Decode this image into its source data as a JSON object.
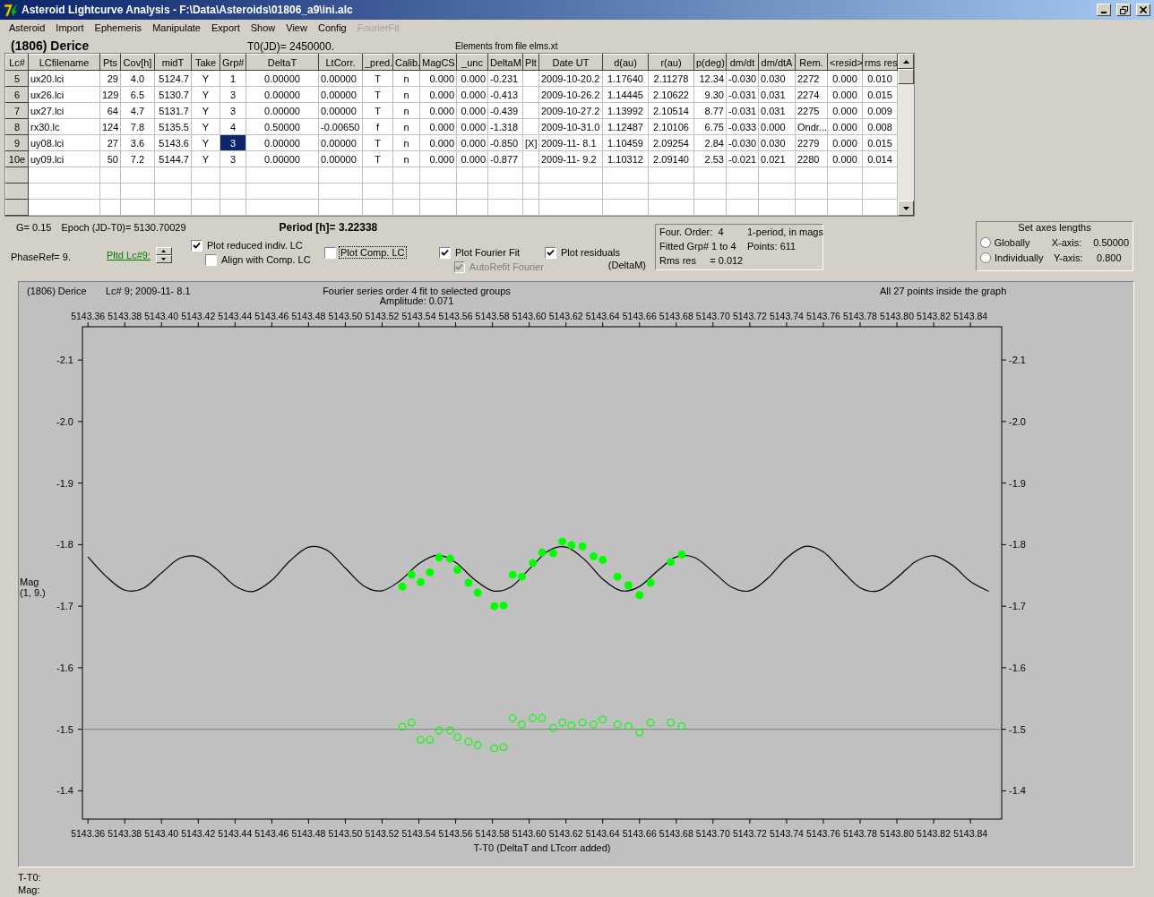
{
  "window": {
    "title": "Asteroid Lightcurve Analysis - F:\\Data\\Asteroids\\01806_a9\\ini.alc"
  },
  "menu": [
    {
      "label": "Asteroid",
      "disabled": false
    },
    {
      "label": "Import",
      "disabled": false
    },
    {
      "label": "Ephemeris",
      "disabled": false
    },
    {
      "label": "Manipulate",
      "disabled": false
    },
    {
      "label": "Export",
      "disabled": false
    },
    {
      "label": "Show",
      "disabled": false
    },
    {
      "label": "View",
      "disabled": false
    },
    {
      "label": "Config",
      "disabled": false
    },
    {
      "label": "FourierFit",
      "disabled": true
    }
  ],
  "info": {
    "asteroid": "(1806) Derice",
    "t0": "T0(JD)= 2450000.",
    "elements": "Elements from file elms.xt"
  },
  "table": {
    "columns": [
      "Lc#",
      "LCfilename",
      "Pts",
      "Cov[h]",
      "midT",
      "Take",
      "Grp#",
      "DeltaT",
      "LtCorr.",
      "_pred.",
      "Calib.",
      "MagCS",
      "_unc",
      "DeltaM",
      "Plt",
      "Date UT",
      "d(au)",
      "r(au)",
      "p(deg)",
      "dm/dt",
      "dm/dtA",
      "Rem.",
      "<resid>",
      "rms res"
    ],
    "rows": [
      {
        "selected": false,
        "cells": [
          "5",
          "ux20.lci",
          "29",
          "4.0",
          "5124.7",
          "Y",
          "1",
          "0.00000",
          "0.00000",
          "T",
          "n",
          "0.000",
          "0.000",
          "-0.231",
          null,
          "2009-10-20.2",
          "1.17640",
          "2.11278",
          "12.34",
          "-0.030",
          "0.030",
          "2272",
          "0.000",
          "0.010"
        ]
      },
      {
        "selected": false,
        "cells": [
          "6",
          "ux26.lci",
          "129",
          "6.5",
          "5130.7",
          "Y",
          "3",
          "0.00000",
          "0.00000",
          "T",
          "n",
          "0.000",
          "0.000",
          "-0.413",
          null,
          "2009-10-26.2",
          "1.14445",
          "2.10622",
          "9.30",
          "-0.031",
          "0.031",
          "2274",
          "0.000",
          "0.015"
        ]
      },
      {
        "selected": false,
        "cells": [
          "7",
          "ux27.lci",
          "64",
          "4.7",
          "5131.7",
          "Y",
          "3",
          "0.00000",
          "0.00000",
          "T",
          "n",
          "0.000",
          "0.000",
          "-0.439",
          null,
          "2009-10-27.2",
          "1.13992",
          "2.10514",
          "8.77",
          "-0.031",
          "0.031",
          "2275",
          "0.000",
          "0.009"
        ]
      },
      {
        "selected": false,
        "cells": [
          "8",
          "rx30.lc",
          "124",
          "7.8",
          "5135.5",
          "Y",
          "4",
          "0.50000",
          "-0.00650",
          "f",
          "n",
          "0.000",
          "0.000",
          "-1.318",
          null,
          "2009-10-31.0",
          "1.12487",
          "2.10106",
          "6.75",
          "-0.033",
          "0.000",
          "Ondr...",
          "0.000",
          "0.008"
        ]
      },
      {
        "selected": true,
        "cells": [
          "9",
          "uy08.lci",
          "27",
          "3.6",
          "5143.6",
          "Y",
          "3",
          "0.00000",
          "0.00000",
          "T",
          "n",
          "0.000",
          "0.000",
          "-0.850",
          "[X]",
          "2009-11- 8.1",
          "1.10459",
          "2.09254",
          "2.84",
          "-0.030",
          "0.030",
          "2279",
          "0.000",
          "0.015"
        ]
      },
      {
        "selected": false,
        "cells": [
          "10e",
          "uy09.lci",
          "50",
          "7.2",
          "5144.7",
          "Y",
          "3",
          "0.00000",
          "0.00000",
          "T",
          "n",
          "0.000",
          "0.000",
          "-0.877",
          null,
          "2009-11- 9.2",
          "1.10312",
          "2.09140",
          "2.53",
          "-0.021",
          "0.021",
          "2280",
          "0.000",
          "0.014"
        ]
      }
    ]
  },
  "params": {
    "g": "G= 0.15",
    "epoch": "Epoch (JD-T0)= 5130.70029",
    "period": "Period [h]= 3.22338",
    "phase_ref": "PhaseRef= 9.",
    "plotted_lc": "Pltd Lc#9:",
    "deltam_note": "(DeltaM)"
  },
  "checkboxes": [
    {
      "label": "Plot reduced indiv. LC",
      "checked": true,
      "disabled": false,
      "focused": false
    },
    {
      "label": "Align with Comp. LC",
      "checked": false,
      "disabled": false,
      "focused": false
    },
    {
      "label": "Plot Comp. LC",
      "checked": false,
      "disabled": false,
      "focused": true
    },
    {
      "label": "Plot Fourier Fit",
      "checked": true,
      "disabled": false,
      "focused": false
    },
    {
      "label": "AutoRefit Fourier",
      "checked": true,
      "disabled": true,
      "focused": false
    },
    {
      "label": "Plot residuals",
      "checked": true,
      "disabled": false,
      "focused": false
    }
  ],
  "fit_info": [
    [
      "Four. Order:  4",
      "1-period, in mags"
    ],
    [
      "Fitted Grp# 1 to 4",
      "Points: 611"
    ],
    [
      "Rms res     = 0.012"
    ]
  ],
  "axes_box": {
    "title": "Set axes lengths",
    "options": [
      {
        "label": "Globally",
        "selected": false,
        "axis": "X-axis:",
        "value": "0.50000"
      },
      {
        "label": "Individually",
        "selected": false,
        "axis": "Y-axis:",
        "value": "0.800"
      }
    ]
  },
  "plot": {
    "asteroid": "(1806) Derice",
    "lc": "Lc# 9; 2009-11- 8.1",
    "fit": "Fourier series order 4 fit to selected groups",
    "amplitude": "Amplitude: 0.071",
    "status": "All 27 points inside the graph",
    "y_note": "(1, 9.)",
    "chart_data": {
      "type": "scatter",
      "xlabel": "T-T0 (DeltaT and LTcorr added)",
      "ylabel": "Mag",
      "xlim": [
        5143.357,
        5143.857
      ],
      "ylim": [
        -1.354,
        -2.154
      ],
      "xticks": [
        {
          "value": 5143.36,
          "label": "5143.36"
        },
        {
          "value": 5143.38,
          "label": "5143.38"
        },
        {
          "value": 5143.4,
          "label": "5143.40"
        },
        {
          "value": 5143.42,
          "label": "5143.42"
        },
        {
          "value": 5143.44,
          "label": "5143.44"
        },
        {
          "value": 5143.46,
          "label": "5143.46"
        },
        {
          "value": 5143.48,
          "label": "5143.48"
        },
        {
          "value": 5143.5,
          "label": "5143.50"
        },
        {
          "value": 5143.52,
          "label": "5143.52"
        },
        {
          "value": 5143.54,
          "label": "5143.54"
        },
        {
          "value": 5143.56,
          "label": "5143.56"
        },
        {
          "value": 5143.58,
          "label": "5143.58"
        },
        {
          "value": 5143.6,
          "label": "5143.60"
        },
        {
          "value": 5143.62,
          "label": "5143.62"
        },
        {
          "value": 5143.64,
          "label": "5143.64"
        },
        {
          "value": 5143.66,
          "label": "5143.66"
        },
        {
          "value": 5143.68,
          "label": "5143.68"
        },
        {
          "value": 5143.7,
          "label": "5143.70"
        },
        {
          "value": 5143.72,
          "label": "5143.72"
        },
        {
          "value": 5143.74,
          "label": "5143.74"
        },
        {
          "value": 5143.76,
          "label": "5143.76"
        },
        {
          "value": 5143.78,
          "label": "5143.78"
        },
        {
          "value": 5143.8,
          "label": "5143.80"
        },
        {
          "value": 5143.82,
          "label": "5143.82"
        },
        {
          "value": 5143.84,
          "label": "5143.84"
        }
      ],
      "yticks": [
        {
          "value": -2.1,
          "label": "-2.1"
        },
        {
          "value": -2.0,
          "label": "-2.0"
        },
        {
          "value": -1.9,
          "label": "-1.9"
        },
        {
          "value": -1.8,
          "label": "-1.8"
        },
        {
          "value": -1.7,
          "label": "-1.7"
        },
        {
          "value": -1.6,
          "label": "-1.6"
        },
        {
          "value": -1.5,
          "label": "-1.5"
        },
        {
          "value": -1.4,
          "label": "-1.4"
        }
      ],
      "series": [
        {
          "type": "line",
          "color": "#000000",
          "x": [
            5143.36,
            5143.37,
            5143.38,
            5143.39,
            5143.4,
            5143.41,
            5143.42,
            5143.43,
            5143.44,
            5143.45,
            5143.46,
            5143.47,
            5143.48,
            5143.49,
            5143.5,
            5143.51,
            5143.52,
            5143.53,
            5143.54,
            5143.55,
            5143.56,
            5143.57,
            5143.58,
            5143.59,
            5143.6,
            5143.61,
            5143.62,
            5143.63,
            5143.64,
            5143.65,
            5143.66,
            5143.67,
            5143.68,
            5143.69,
            5143.7,
            5143.71,
            5143.72,
            5143.73,
            5143.74,
            5143.75,
            5143.76,
            5143.77,
            5143.78,
            5143.79,
            5143.8,
            5143.81,
            5143.82,
            5143.83,
            5143.84,
            5143.85
          ],
          "values": [
            -1.78,
            -1.748,
            -1.726,
            -1.729,
            -1.754,
            -1.778,
            -1.78,
            -1.76,
            -1.733,
            -1.724,
            -1.742,
            -1.774,
            -1.796,
            -1.791,
            -1.762,
            -1.733,
            -1.725,
            -1.742,
            -1.769,
            -1.783,
            -1.771,
            -1.744,
            -1.725,
            -1.731,
            -1.76,
            -1.789,
            -1.796,
            -1.776,
            -1.744,
            -1.725,
            -1.732,
            -1.758,
            -1.78,
            -1.779,
            -1.756,
            -1.731,
            -1.725,
            -1.746,
            -1.778,
            -1.797,
            -1.788,
            -1.758,
            -1.73,
            -1.725,
            -1.746,
            -1.772,
            -1.782,
            -1.767,
            -1.74,
            -1.724
          ]
        },
        {
          "type": "scatter",
          "color": "#00ff00",
          "x": [
            5143.531,
            5143.536,
            5143.541,
            5143.546,
            5143.551,
            5143.557,
            5143.561,
            5143.567,
            5143.572,
            5143.581,
            5143.586,
            5143.591,
            5143.596,
            5143.602,
            5143.607,
            5143.613,
            5143.618,
            5143.623,
            5143.629,
            5143.635,
            5143.64,
            5143.648,
            5143.654,
            5143.66,
            5143.666,
            5143.677,
            5143.683
          ],
          "values": [
            -1.732,
            -1.751,
            -1.739,
            -1.755,
            -1.779,
            -1.777,
            -1.759,
            -1.738,
            -1.722,
            -1.7,
            -1.701,
            -1.751,
            -1.748,
            -1.77,
            -1.787,
            -1.786,
            -1.805,
            -1.799,
            -1.797,
            -1.781,
            -1.775,
            -1.748,
            -1.734,
            -1.718,
            -1.738,
            -1.772,
            -1.784
          ]
        },
        {
          "type": "scatter",
          "color": "#00ff00",
          "x": [
            5143.531,
            5143.536,
            5143.541,
            5143.546,
            5143.551,
            5143.557,
            5143.561,
            5143.567,
            5143.572,
            5143.581,
            5143.586,
            5143.591,
            5143.596,
            5143.602,
            5143.607,
            5143.613,
            5143.618,
            5143.623,
            5143.629,
            5143.635,
            5143.64,
            5143.648,
            5143.654,
            5143.66,
            5143.666,
            5143.677,
            5143.683
          ],
          "values": [
            -1.504,
            -1.511,
            -1.483,
            -1.483,
            -1.498,
            -1.498,
            -1.487,
            -1.48,
            -1.474,
            -1.469,
            -1.471,
            -1.518,
            -1.508,
            -1.518,
            -1.518,
            -1.502,
            -1.511,
            -1.506,
            -1.511,
            -1.508,
            -1.516,
            -1.508,
            -1.505,
            -1.495,
            -1.511,
            -1.511,
            -1.505
          ]
        }
      ],
      "ref_lines": [
        {
          "axis": "y",
          "value": -1.5
        }
      ]
    }
  },
  "footer": [
    "T-T0:",
    "Mag:"
  ]
}
